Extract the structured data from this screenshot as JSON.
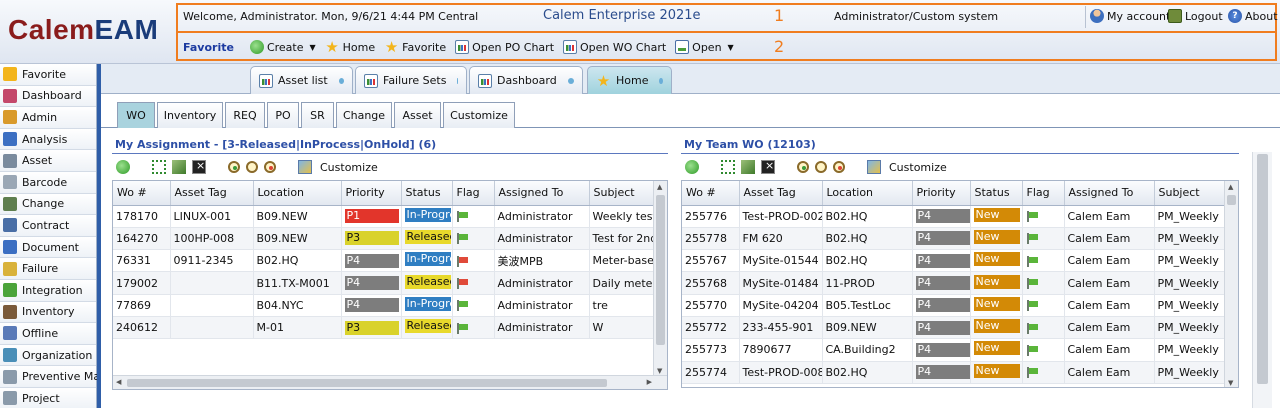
{
  "header": {
    "logo_part1": "Calem",
    "logo_part2": "EAM",
    "welcome": "Welcome, Administrator. Mon, 9/6/21 4:44 PM Central",
    "product": "Calem Enterprise 2021e",
    "annotation_1": "1",
    "annotation_2": "2",
    "user_system": "Administrator/Custom system",
    "my_account": "My account",
    "logout": "Logout",
    "about": "About"
  },
  "toolbar": {
    "favorite": "Favorite",
    "create": "Create",
    "home": "Home",
    "favorite2": "Favorite",
    "open_po_chart": "Open PO Chart",
    "open_wo_chart": "Open WO Chart",
    "open": "Open"
  },
  "leftnav": {
    "items": [
      {
        "label": "Favorite",
        "color": "#f3b51c"
      },
      {
        "label": "Dashboard",
        "color": "#c4486b"
      },
      {
        "label": "Admin",
        "color": "#d99a2b"
      },
      {
        "label": "Analysis",
        "color": "#3c6fc2"
      },
      {
        "label": "Asset",
        "color": "#7a8b9e"
      },
      {
        "label": "Barcode",
        "color": "#9aa7b5"
      },
      {
        "label": "Change",
        "color": "#5f7f4f"
      },
      {
        "label": "Contract",
        "color": "#4a6fa6"
      },
      {
        "label": "Document",
        "color": "#3c6fc2"
      },
      {
        "label": "Failure",
        "color": "#d9b23a"
      },
      {
        "label": "Integration",
        "color": "#4aa33a"
      },
      {
        "label": "Inventory",
        "color": "#7a5a3a"
      },
      {
        "label": "Offline",
        "color": "#5a7ab8"
      },
      {
        "label": "Organization",
        "color": "#4a8fb8"
      },
      {
        "label": "Preventive Main",
        "color": "#8a9aaa"
      },
      {
        "label": "Project",
        "color": "#8a9aaa"
      }
    ]
  },
  "doctabs": {
    "items": [
      {
        "label": "Asset list"
      },
      {
        "label": "Failure Sets"
      },
      {
        "label": "Dashboard"
      },
      {
        "label": "Home"
      }
    ]
  },
  "subtabs": {
    "items": [
      {
        "label": "WO"
      },
      {
        "label": "Inventory"
      },
      {
        "label": "REQ"
      },
      {
        "label": "PO"
      },
      {
        "label": "SR"
      },
      {
        "label": "Change"
      },
      {
        "label": "Asset"
      },
      {
        "label": "Customize"
      }
    ]
  },
  "colors": {
    "P1": "#e2352b",
    "P3": "#d9d22b",
    "P4": "#7d7d7d",
    "In-Progress": "#2f7ec2",
    "Released": "#e8d92b",
    "New": "#d38a06",
    "flag_green": "#5ab53a",
    "flag_red": "#e04a3a"
  },
  "left_panel": {
    "title": "My Assignment - [3-Released|InProcess|OnHold] (6)",
    "customize": "Customize",
    "columns": [
      "Wo #",
      "Asset Tag",
      "Location",
      "Priority",
      "Status",
      "Flag",
      "Assigned To",
      "Subject"
    ],
    "rows": [
      {
        "wo": "178170",
        "asset": "LINUX-001",
        "location": "B09.NEW",
        "priority": "P1",
        "status": "In-Progress",
        "flag": "green",
        "assigned": "Administrator",
        "subject": "Weekly test P"
      },
      {
        "wo": "164270",
        "asset": "100HP-008",
        "location": "B09.NEW",
        "priority": "P3",
        "status": "Released",
        "flag": "green",
        "assigned": "Administrator",
        "subject": "Test for 2nd W"
      },
      {
        "wo": "76331",
        "asset": "0911-2345",
        "location": "B02.HQ",
        "priority": "P4",
        "status": "In-Progress",
        "flag": "red",
        "assigned": "美波MPB",
        "subject": "Meter-based"
      },
      {
        "wo": "179002",
        "asset": "",
        "location": "B11.TX-M001",
        "priority": "P4",
        "status": "Released",
        "flag": "red",
        "assigned": "Administrator",
        "subject": "Daily meter re"
      },
      {
        "wo": "77869",
        "asset": "",
        "location": "B04.NYC",
        "priority": "P4",
        "status": "In-Progress",
        "flag": "green",
        "assigned": "Administrator",
        "subject": "tre"
      },
      {
        "wo": "240612",
        "asset": "",
        "location": "M-01",
        "priority": "P3",
        "status": "Released",
        "flag": "green",
        "assigned": "Administrator",
        "subject": "W"
      }
    ]
  },
  "right_panel": {
    "title": "My Team WO (12103)",
    "customize": "Customize",
    "columns": [
      "Wo #",
      "Asset Tag",
      "Location",
      "Priority",
      "Status",
      "Flag",
      "Assigned To",
      "Subject"
    ],
    "rows": [
      {
        "wo": "255776",
        "asset": "Test-PROD-002",
        "location": "B02.HQ",
        "priority": "P4",
        "status": "New",
        "flag": "green",
        "assigned": "Calem Eam",
        "subject": "PM_Weekly"
      },
      {
        "wo": "255778",
        "asset": "FM 620",
        "location": "B02.HQ",
        "priority": "P4",
        "status": "New",
        "flag": "green",
        "assigned": "Calem Eam",
        "subject": "PM_Weekly"
      },
      {
        "wo": "255767",
        "asset": "MySite-01544",
        "location": "B02.HQ",
        "priority": "P4",
        "status": "New",
        "flag": "green",
        "assigned": "Calem Eam",
        "subject": "PM_Weekly"
      },
      {
        "wo": "255768",
        "asset": "MySite-01484",
        "location": "11-PROD",
        "priority": "P4",
        "status": "New",
        "flag": "green",
        "assigned": "Calem Eam",
        "subject": "PM_Weekly"
      },
      {
        "wo": "255770",
        "asset": "MySite-04204",
        "location": "B05.TestLoc",
        "priority": "P4",
        "status": "New",
        "flag": "green",
        "assigned": "Calem Eam",
        "subject": "PM_Weekly"
      },
      {
        "wo": "255772",
        "asset": "233-455-901",
        "location": "B09.NEW",
        "priority": "P4",
        "status": "New",
        "flag": "green",
        "assigned": "Calem Eam",
        "subject": "PM_Weekly"
      },
      {
        "wo": "255773",
        "asset": "7890677",
        "location": "CA.Building2",
        "priority": "P4",
        "status": "New",
        "flag": "green",
        "assigned": "Calem Eam",
        "subject": "PM_Weekly"
      },
      {
        "wo": "255774",
        "asset": "Test-PROD-008",
        "location": "B02.HQ",
        "priority": "P4",
        "status": "New",
        "flag": "green",
        "assigned": "Calem Eam",
        "subject": "PM_Weekly"
      }
    ]
  }
}
